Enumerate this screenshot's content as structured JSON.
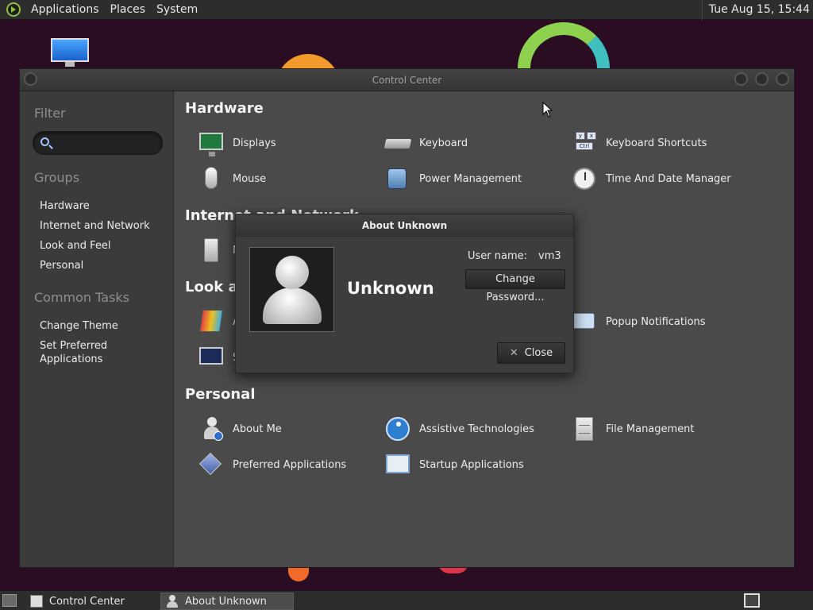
{
  "top_panel": {
    "menus": [
      "Applications",
      "Places",
      "System"
    ],
    "clock": "Tue Aug 15, 15:44"
  },
  "control_center": {
    "title": "Control Center",
    "sidebar": {
      "filter_heading": "Filter",
      "search_placeholder": "",
      "groups_heading": "Groups",
      "groups": [
        "Hardware",
        "Internet and Network",
        "Look and Feel",
        "Personal"
      ],
      "common_tasks_heading": "Common Tasks",
      "tasks": [
        "Change Theme",
        "Set Preferred\nApplications"
      ]
    },
    "sections": {
      "hardware": {
        "title": "Hardware",
        "items": [
          "Displays",
          "Keyboard",
          "Keyboard Shortcuts",
          "Mouse",
          "Power Management",
          "Time And Date Manager"
        ]
      },
      "internet": {
        "title": "Internet and Network",
        "items": [
          "N"
        ]
      },
      "look": {
        "title": "Look an",
        "items": [
          "A",
          "Popup Notifications",
          "S"
        ]
      },
      "personal": {
        "title": "Personal",
        "items": [
          "About Me",
          "Assistive Technologies",
          "File Management",
          "Preferred Applications",
          "Startup Applications"
        ]
      }
    }
  },
  "about_dialog": {
    "title": "About Unknown",
    "full_name": "Unknown",
    "username_label": "User name:",
    "username_value": "vm3",
    "change_password_label": "Change Password...",
    "close_label": "Close"
  },
  "bottom_panel": {
    "tasks": [
      "Control Center",
      "About Unknown"
    ]
  },
  "colors": {
    "desktop_bg": "#2a0d22",
    "window_bg": "#4a4a4a",
    "sidebar_bg": "#3b3b3b",
    "accent_green": "#8ed14f",
    "accent_orange": "#f29a2b"
  }
}
